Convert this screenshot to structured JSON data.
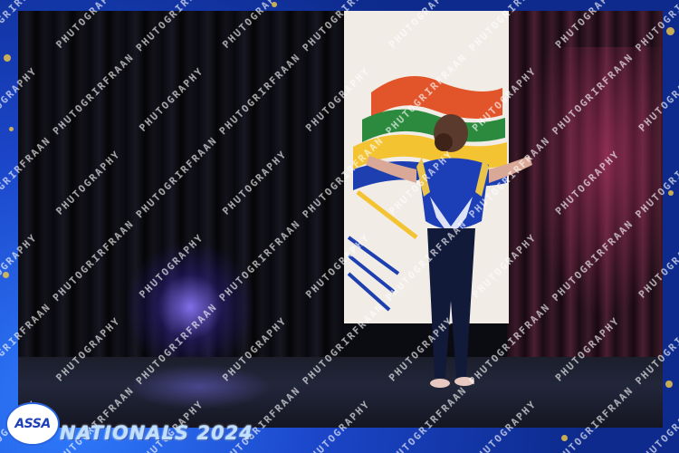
{
  "watermark": {
    "text": "IRFRAAN PHUTOGRAPHY",
    "color": "#ffffff"
  },
  "logo": {
    "text": "ASSA"
  },
  "event": {
    "title": "NATIONALS 2024"
  },
  "colors": {
    "frame": "#1b45c8",
    "accent_gold": "#e9c34a",
    "leotard": "#1c3fb8"
  }
}
